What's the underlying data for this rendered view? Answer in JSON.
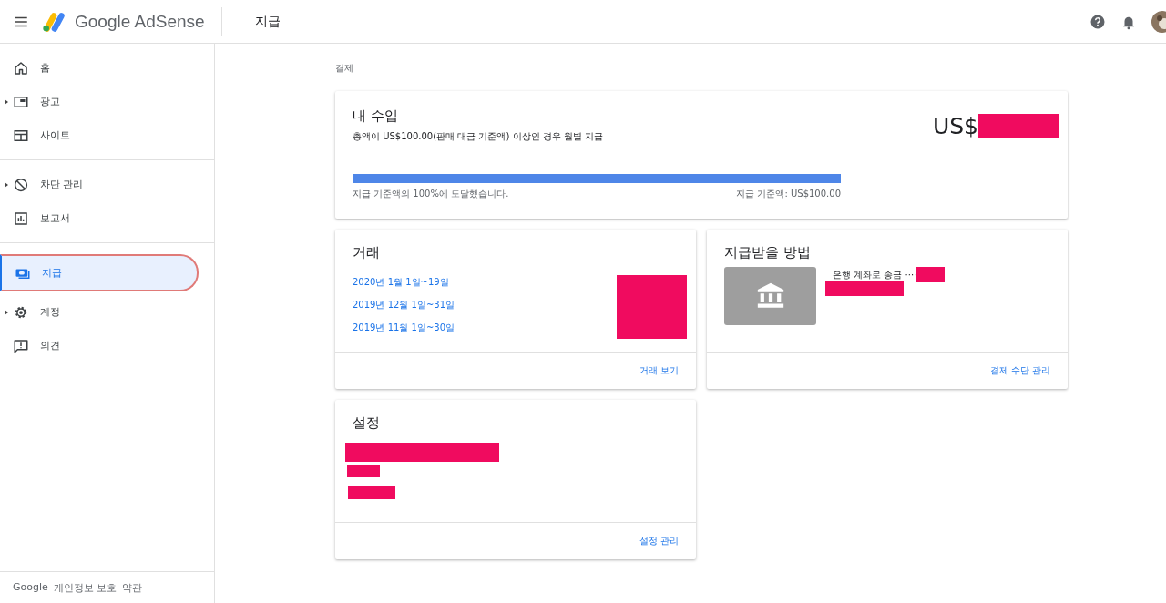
{
  "header": {
    "product": "Google AdSense",
    "page_title": "지급"
  },
  "sidebar": {
    "groups": [
      [
        {
          "label": "홈",
          "expandable": false,
          "selected": false
        },
        {
          "label": "광고",
          "expandable": true,
          "selected": false
        },
        {
          "label": "사이트",
          "expandable": false,
          "selected": false
        }
      ],
      [
        {
          "label": "차단 관리",
          "expandable": true,
          "selected": false
        },
        {
          "label": "보고서",
          "expandable": false,
          "selected": false
        }
      ],
      [
        {
          "label": "지급",
          "expandable": false,
          "selected": true
        },
        {
          "label": "계정",
          "expandable": true,
          "selected": false
        },
        {
          "label": "의견",
          "expandable": false,
          "selected": false
        }
      ]
    ],
    "footer": [
      "Google",
      "개인정보 보호",
      "약관"
    ]
  },
  "breadcrumb": "결제",
  "earnings": {
    "title": "내 수입",
    "subtitle": "총액이 US$100.00(판매 대금 기준액) 이상인 경우 월별 지급",
    "amount_prefix": "US$",
    "progress": {
      "level": 1,
      "caption": "지급 기준액의 100%에 도달했습니다.",
      "threshold": "지급 기준액: US$100.00"
    }
  },
  "transactions": {
    "title": "거래",
    "periods": [
      "2020년 1월 1일~19일",
      "2019년 12월 1일~31일",
      "2019년 11월 1일~30일"
    ],
    "action": "거래 보기"
  },
  "payment_method": {
    "title": "지급받을 방법",
    "method": "은행 계좌로 송금 ····",
    "action": "결제 수단 관리"
  },
  "settings": {
    "title": "설정",
    "action": "설정 관리"
  }
}
